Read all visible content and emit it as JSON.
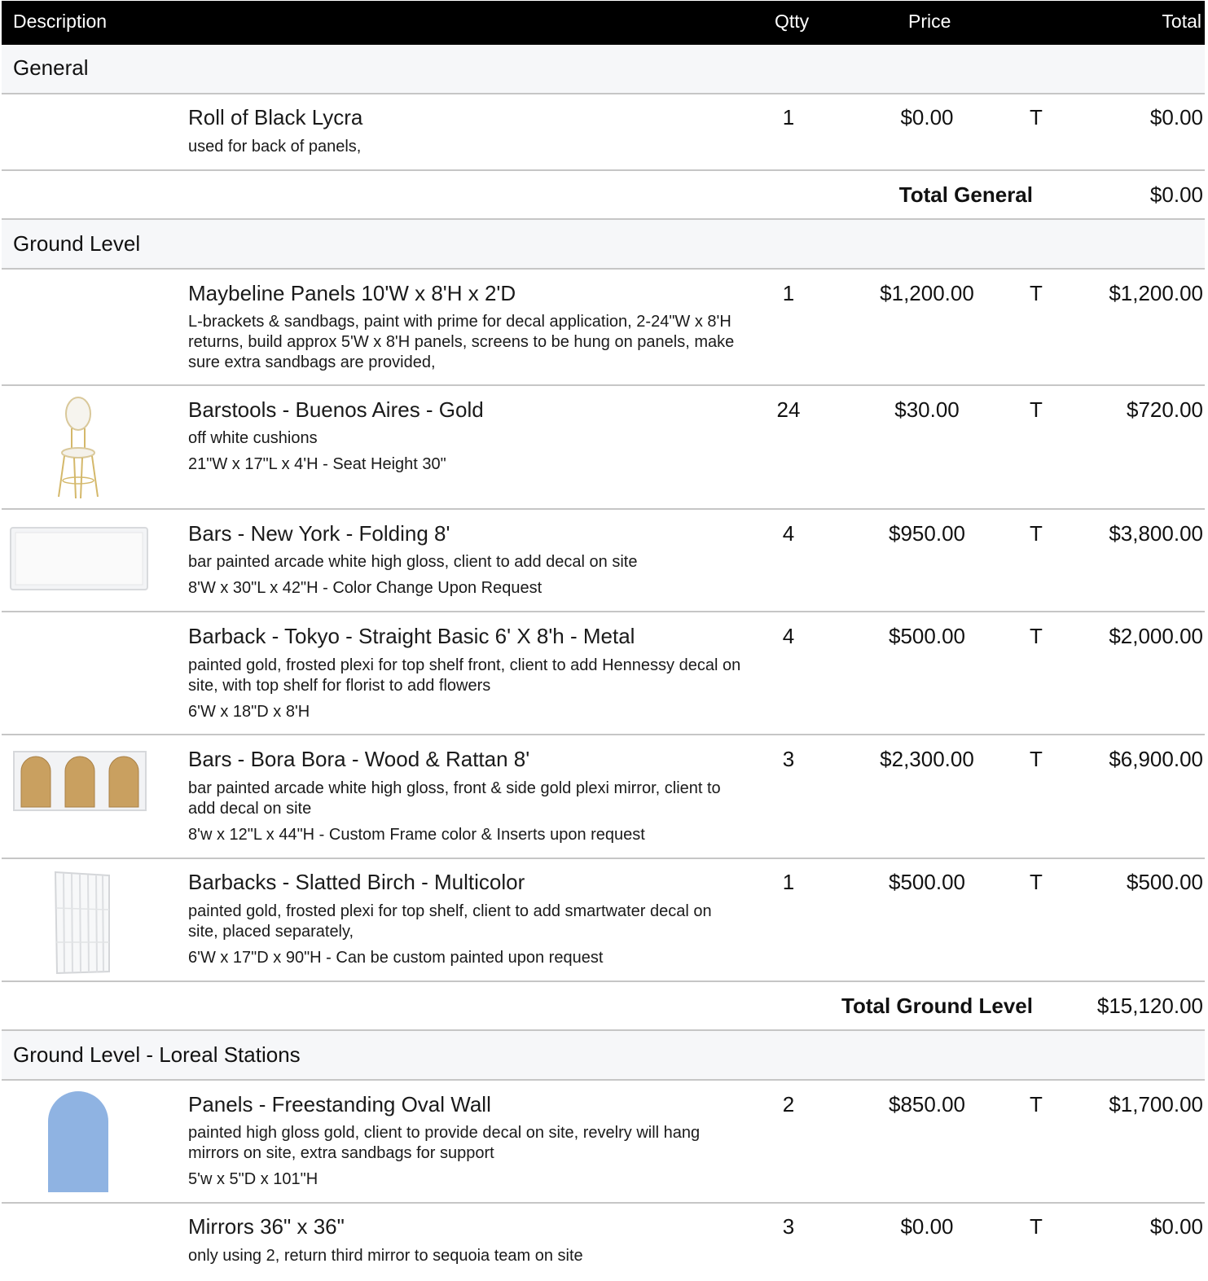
{
  "header": {
    "description": "Description",
    "qty": "Qtty",
    "price": "Price",
    "total": "Total"
  },
  "sections": [
    {
      "title": "General",
      "items": [
        {
          "name": "Roll of Black Lycra",
          "note": "used for back of panels,",
          "dims": "",
          "qty": "1",
          "price": "$0.00",
          "tax": "T",
          "total": "$0.00",
          "image": ""
        }
      ],
      "subtotal_label": "Total General",
      "subtotal": "$0.00"
    },
    {
      "title": "Ground Level",
      "items": [
        {
          "name": "Maybeline Panels 10'W x 8'H x 2'D",
          "note": "L-brackets & sandbags, paint with prime for decal application, 2-24\"W x 8'H returns, build approx 5'W x 8'H panels, screens to be hung on panels, make sure extra sandbags are provided,",
          "dims": "",
          "qty": "1",
          "price": "$1,200.00",
          "tax": "T",
          "total": "$1,200.00",
          "image": ""
        },
        {
          "name": "Barstools - Buenos Aires - Gold",
          "note": "off white cushions",
          "dims": "21\"W x 17\"L x 4'H - Seat Height 30\"",
          "qty": "24",
          "price": "$30.00",
          "tax": "T",
          "total": "$720.00",
          "image": "barstool-image"
        },
        {
          "name": "Bars - New York -  Folding 8'",
          "note": "bar painted arcade white high gloss, client to add decal on site",
          "dims": "8'W x 30\"L x 42\"H - Color Change Upon Request",
          "qty": "4",
          "price": "$950.00",
          "tax": "T",
          "total": "$3,800.00",
          "image": "white-bar-image"
        },
        {
          "name": "Barback - Tokyo - Straight Basic 6' X 8'h -  Metal",
          "note": "painted gold, frosted plexi for top shelf front, client to add Hennessy decal on site, with top shelf for florist to add flowers",
          "dims": "6'W x 18\"D x 8'H",
          "qty": "4",
          "price": "$500.00",
          "tax": "T",
          "total": "$2,000.00",
          "image": ""
        },
        {
          "name": "Bars - Bora Bora - Wood & Rattan 8'",
          "note": "bar painted arcade white high gloss, front & side gold plexi mirror, client to add decal on site",
          "dims": "8'w x 12\"L x 44\"H  - Custom Frame color & Inserts upon request",
          "qty": "3",
          "price": "$2,300.00",
          "tax": "T",
          "total": "$6,900.00",
          "image": "rattan-bar-image"
        },
        {
          "name": "Barbacks - Slatted Birch - Multicolor",
          "note": "painted gold, frosted plexi for top shelf, client to add smartwater decal on site, placed separately,",
          "dims": "6'W x 17\"D x 90\"H - Can be custom painted upon request",
          "qty": "1",
          "price": "$500.00",
          "tax": "T",
          "total": "$500.00",
          "image": "slatted-barback-image"
        }
      ],
      "subtotal_label": "Total Ground Level",
      "subtotal": "$15,120.00"
    },
    {
      "title": "Ground Level - Loreal Stations",
      "items": [
        {
          "name": "Panels - Freestanding Oval Wall",
          "note": "painted high gloss gold, client to provide decal on site, revelry will hang mirrors on site, extra sandbags for support",
          "dims": "5'w x 5\"D x 101\"H",
          "qty": "2",
          "price": "$850.00",
          "tax": "T",
          "total": "$1,700.00",
          "image": "oval-wall-image"
        },
        {
          "name": "Mirrors 36\" x 36\"",
          "note": "only using 2, return third mirror to sequoia team on site",
          "dims": "",
          "qty": "3",
          "price": "$0.00",
          "tax": "T",
          "total": "$0.00",
          "image": ""
        }
      ]
    }
  ]
}
